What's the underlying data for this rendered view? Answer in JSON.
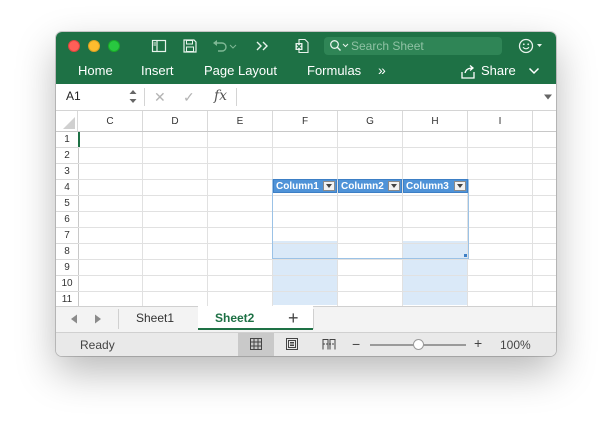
{
  "toolbar": {
    "search_placeholder": "Search Sheet"
  },
  "ribbon": {
    "tabs": [
      "Home",
      "Insert",
      "Page Layout",
      "Formulas"
    ],
    "more": "»",
    "share_label": "Share"
  },
  "formula_bar": {
    "name_box": "A1",
    "fx_label": "fx",
    "formula_value": ""
  },
  "grid": {
    "columns": [
      "C",
      "D",
      "E",
      "F",
      "G",
      "H",
      "I"
    ],
    "rows": [
      "1",
      "2",
      "3",
      "4",
      "5",
      "6",
      "7",
      "8",
      "9",
      "10",
      "11"
    ],
    "table_headers": [
      "Column1",
      "Column2",
      "Column3"
    ]
  },
  "sheets": {
    "tabs": [
      "Sheet1",
      "Sheet2"
    ],
    "active": "Sheet2",
    "add_label": "+"
  },
  "status": {
    "text": "Ready",
    "zoom_minus": "−",
    "zoom_plus": "+",
    "zoom_level": "100%"
  },
  "colors": {
    "accent": "#1e7145",
    "table_header": "#4f93d8",
    "table_band": "#dae9f8"
  }
}
